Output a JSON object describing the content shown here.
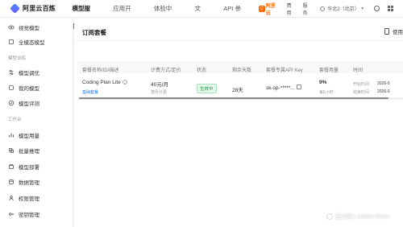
{
  "topbar": {
    "logo_text": "阿里云百炼",
    "nav": [
      "模型服务",
      "应用开发",
      "体验中心",
      "文档",
      "API 参考"
    ],
    "promo_badge": "C",
    "promo_text": "阿里云",
    "links": [
      "费用",
      "服务"
    ],
    "region": "华北2（北京）"
  },
  "sidebar": {
    "items_top": [
      "视觉模型",
      "全模态模型"
    ],
    "section1": "模型训练",
    "items_mid": [
      "模型调优",
      "我的模型",
      "模型评测"
    ],
    "section2": "工作台",
    "items_bottom": [
      "模型用量",
      "批量推理",
      "模型部署",
      "数据管理",
      "权限管理",
      "密钥管理"
    ]
  },
  "main": {
    "title": "订阅套餐",
    "header_action": "使用",
    "columns": [
      "套餐名称/ID/描述",
      "计费方式/定价",
      "状态",
      "剩余天数",
      "套餐专属API Key",
      "套餐用量",
      "时间"
    ],
    "row": {
      "name": "Coding Plan Lite",
      "name_sub": "基础套餐",
      "price": "40元/月",
      "price_sub": "按月计费",
      "status": "生效中",
      "days": "28天",
      "api_key": "sk-sp-*****...",
      "usage": "9%",
      "usage_sub": "每5小时",
      "start_label": "开始时间",
      "start_value": "2026-0",
      "end_label": "结束时间",
      "end_value": "2026-0"
    }
  },
  "watermark": "蓝点网 Landian.News"
}
